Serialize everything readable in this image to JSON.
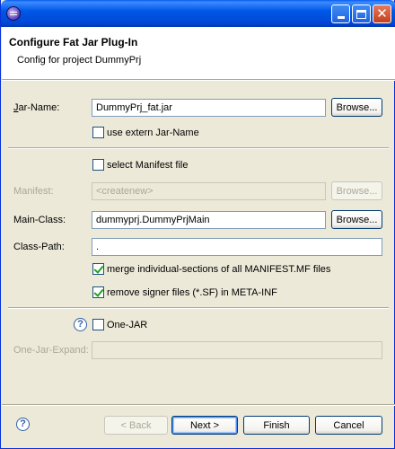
{
  "window": {
    "minimize_icon": "minimize-icon",
    "maximize_icon": "maximize-icon",
    "close_glyph": "✕"
  },
  "header": {
    "title": "Configure Fat Jar Plug-In",
    "subtitle": "Config for project DummyPrj"
  },
  "form": {
    "jar_name": {
      "label": "Jar-Name:",
      "value": "DummyPrj_fat.jar",
      "browse": "Browse..."
    },
    "use_extern": {
      "label": "use extern Jar-Name",
      "checked": false
    },
    "select_manifest": {
      "label": "select Manifest file",
      "checked": false
    },
    "manifest": {
      "label": "Manifest:",
      "value": "<createnew>",
      "browse": "Browse...",
      "disabled": true
    },
    "main_class": {
      "label": "Main-Class:",
      "value": "dummyprj.DummyPrjMain",
      "browse": "Browse..."
    },
    "class_path": {
      "label": "Class-Path:",
      "value": "."
    },
    "merge_manifest": {
      "label": "merge individual-sections of all MANIFEST.MF files",
      "checked": true
    },
    "remove_signer": {
      "label": "remove signer files (*.SF) in META-INF",
      "checked": true
    },
    "one_jar": {
      "label": "One-JAR",
      "checked": false,
      "help": "?"
    },
    "one_jar_expand": {
      "label": "One-Jar-Expand:",
      "value": "",
      "disabled": true
    }
  },
  "footer": {
    "help": "?",
    "back": "< Back",
    "next": "Next >",
    "finish": "Finish",
    "cancel": "Cancel"
  }
}
